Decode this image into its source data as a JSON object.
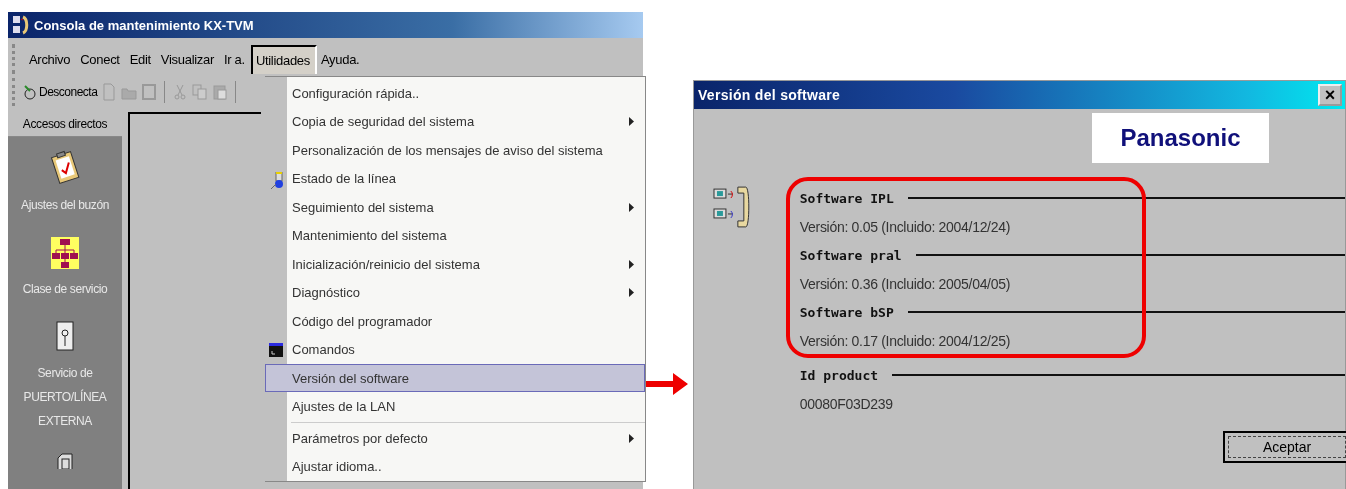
{
  "main_window": {
    "title": "Consola de mantenimiento KX-TVM",
    "menu_bar": [
      {
        "label": "Archivo",
        "selected": false
      },
      {
        "label": "Conect",
        "selected": false
      },
      {
        "label": "Edit",
        "selected": false
      },
      {
        "label": "Visualizar",
        "selected": false
      },
      {
        "label": "Ir a.",
        "selected": false
      },
      {
        "label": "Utilidades",
        "selected": true
      },
      {
        "label": "Ayuda.",
        "selected": false
      }
    ],
    "toolbar": {
      "connect_button": "Desconecta"
    },
    "sidebar": {
      "header": "Accesos directos",
      "items": [
        {
          "label": "Ajustes del buzón",
          "kind": "clipboard"
        },
        {
          "label": "Clase de servicio",
          "kind": "hierarchy"
        },
        {
          "label": "Servicio de PUERTO/LÍNEA EXTERNA",
          "kind": "phone"
        },
        {
          "kind": "device"
        }
      ]
    },
    "utilities_menu": [
      {
        "label": "Configuración rápida..",
        "submenu": false,
        "selected": false
      },
      {
        "label": "Copia de seguridad del sistema",
        "submenu": true,
        "selected": false
      },
      {
        "label": "Personalización de los mensajes de aviso del sistema",
        "submenu": false,
        "selected": false
      },
      {
        "label": "Estado de la línea",
        "submenu": false,
        "selected": false,
        "kind": "status"
      },
      {
        "label": "Seguimiento del sistema",
        "submenu": true,
        "selected": false
      },
      {
        "label": "Mantenimiento del sistema",
        "submenu": false,
        "selected": false
      },
      {
        "label": "Inicialización/reinicio del sistema",
        "submenu": true,
        "selected": false
      },
      {
        "label": "Diagnóstico",
        "submenu": true,
        "selected": false
      },
      {
        "label": "Código del programador",
        "submenu": false,
        "selected": false
      },
      {
        "label": "Comandos",
        "submenu": false,
        "selected": false,
        "kind": "console"
      },
      {
        "label": "Versión del software",
        "submenu": false,
        "selected": true
      },
      {
        "label": "Ajustes de la LAN",
        "submenu": false,
        "selected": false
      },
      {
        "label": "Parámetros por defecto",
        "submenu": true,
        "selected": false,
        "separator_before": true
      },
      {
        "label": "Ajustar idioma..",
        "submenu": false,
        "selected": false
      }
    ]
  },
  "dialog": {
    "title": "Versión del software",
    "close": "×",
    "logo": "Panasonic",
    "groups": [
      {
        "heading": "Software IPL",
        "value": "Versión: 0.05 (Incluido: 2004/12/24)",
        "highlighted": true
      },
      {
        "heading": "Software pral",
        "value": "Versión: 0.36 (Incluido: 2005/04/05)",
        "highlighted": true
      },
      {
        "heading": "Software bSP",
        "value": "Versión: 0.17 (Incluido: 2004/12/25)",
        "highlighted": true
      },
      {
        "heading": "Id product",
        "value": "00080F03D239",
        "highlighted": false
      }
    ],
    "ok_button": "Aceptar"
  }
}
